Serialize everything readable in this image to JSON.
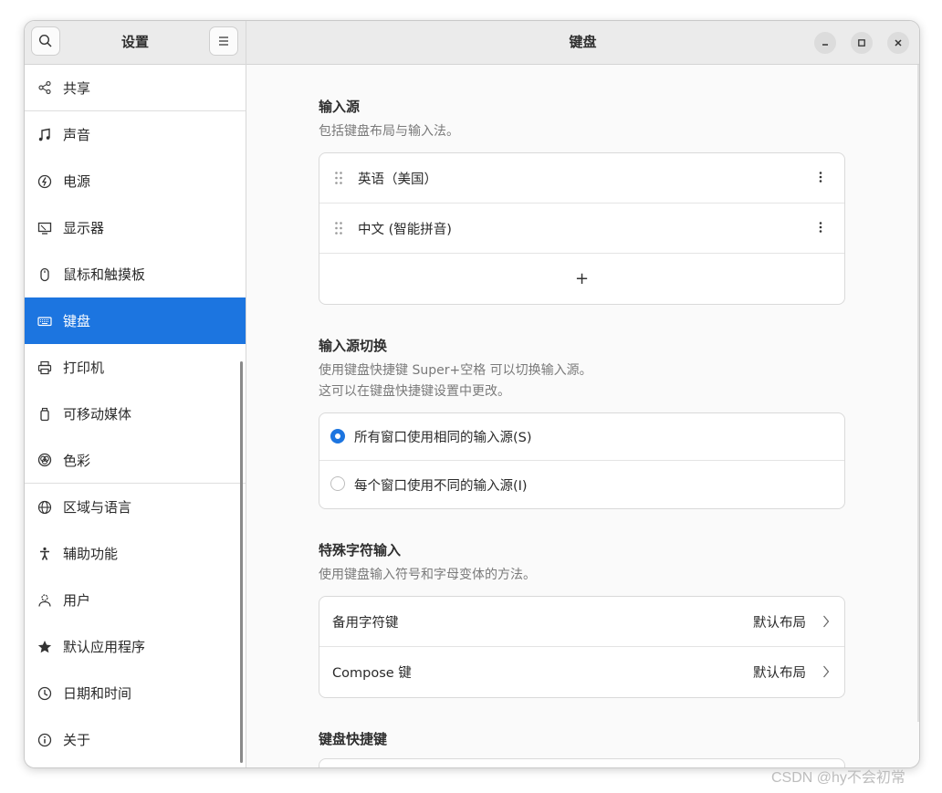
{
  "sidebar": {
    "title": "设置",
    "items": [
      {
        "label": "共享",
        "icon": "share-icon"
      },
      {
        "label": "声音",
        "icon": "music-note-icon"
      },
      {
        "label": "电源",
        "icon": "power-icon"
      },
      {
        "label": "显示器",
        "icon": "display-icon"
      },
      {
        "label": "鼠标和触摸板",
        "icon": "mouse-icon"
      },
      {
        "label": "键盘",
        "icon": "keyboard-icon",
        "active": true
      },
      {
        "label": "打印机",
        "icon": "printer-icon"
      },
      {
        "label": "可移动媒体",
        "icon": "removable-media-icon"
      },
      {
        "label": "色彩",
        "icon": "color-icon"
      },
      {
        "label": "区域与语言",
        "icon": "globe-icon"
      },
      {
        "label": "辅助功能",
        "icon": "accessibility-icon"
      },
      {
        "label": "用户",
        "icon": "users-icon"
      },
      {
        "label": "默认应用程序",
        "icon": "star-icon"
      },
      {
        "label": "日期和时间",
        "icon": "clock-icon"
      },
      {
        "label": "关于",
        "icon": "info-icon"
      }
    ]
  },
  "content": {
    "title": "键盘",
    "input_sources": {
      "title": "输入源",
      "desc": "包括键盘布局与输入法。",
      "items": [
        "英语（美国）",
        "中文 (智能拼音)"
      ],
      "add_label": "+"
    },
    "switching": {
      "title": "输入源切换",
      "desc_line1": "使用键盘快捷键 Super+空格 可以切换输入源。",
      "desc_line2": "这可以在键盘快捷键设置中更改。",
      "options": [
        "所有窗口使用相同的输入源(S)",
        "每个窗口使用不同的输入源(I)"
      ],
      "selected_index": 0
    },
    "special_chars": {
      "title": "特殊字符输入",
      "desc": "使用键盘输入符号和字母变体的方法。",
      "rows": [
        {
          "label": "备用字符键",
          "value": "默认布局"
        },
        {
          "label": "Compose 键",
          "value": "默认布局"
        }
      ]
    },
    "shortcuts": {
      "title": "键盘快捷键"
    }
  },
  "colors": {
    "accent": "#1c75e0",
    "header_bg": "#ebebeb"
  },
  "watermark": "CSDN @hy不会初常"
}
